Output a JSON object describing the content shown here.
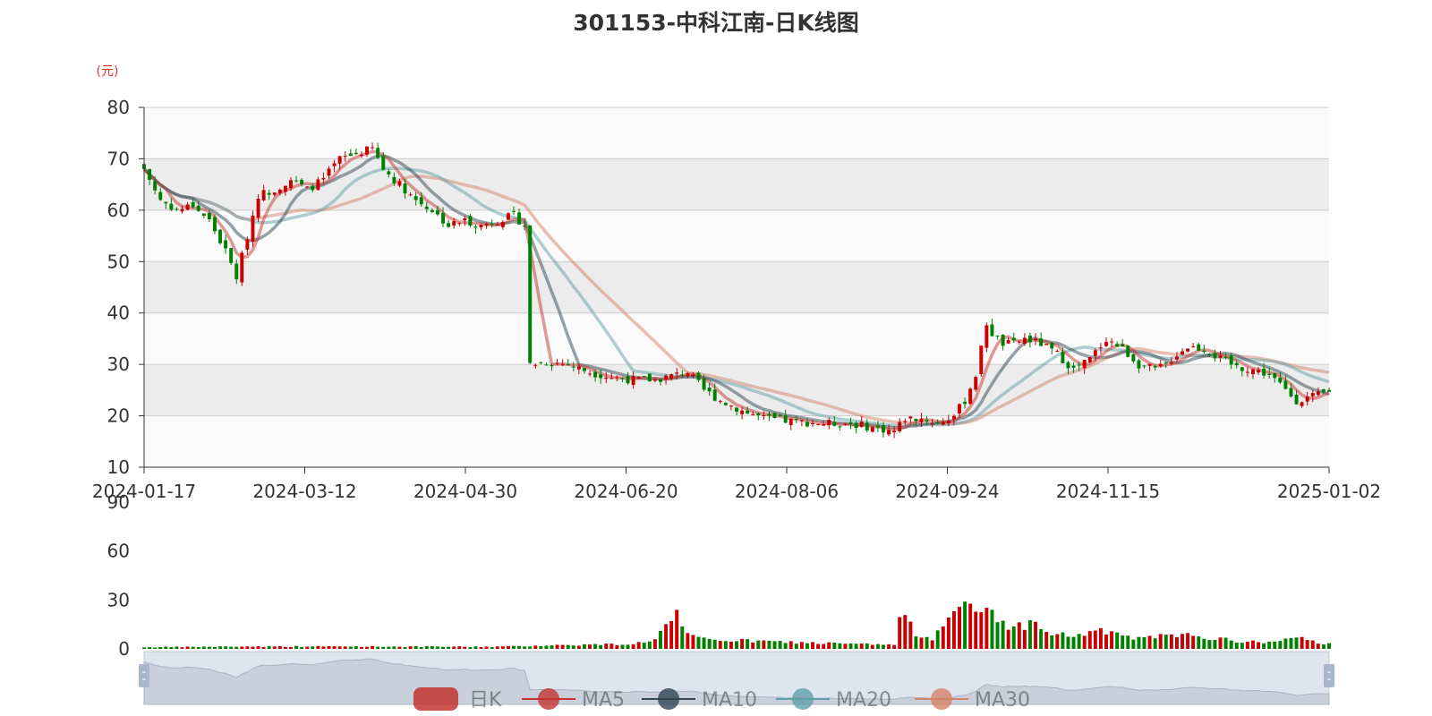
{
  "chart_data": {
    "type": "candlestick",
    "title": "301153-中科江南-日K线图",
    "y_unit": "(元)",
    "price_ylim": [
      10,
      80
    ],
    "price_yticks": [
      "80",
      "70",
      "60",
      "50",
      "40",
      "30",
      "20",
      "10"
    ],
    "volume_ylim": [
      0,
      90
    ],
    "volume_yticks": [
      "90",
      "60",
      "30",
      "0"
    ],
    "x_tick_labels": [
      "2024-01-17",
      "2024-03-12",
      "2024-04-30",
      "2024-06-20",
      "2024-08-06",
      "2024-09-24",
      "2024-11-15",
      "2025-01-02"
    ],
    "legend": [
      {
        "name": "日K",
        "color": "#c23531"
      },
      {
        "name": "MA5",
        "color": "#c23531"
      },
      {
        "name": "MA10",
        "color": "#2f4554"
      },
      {
        "name": "MA20",
        "color": "#61a0a8"
      },
      {
        "name": "MA30",
        "color": "#d48265"
      }
    ],
    "up_color": "#c80000",
    "down_color": "#008000",
    "grid": true,
    "close_anchors": [
      [
        0,
        68
      ],
      [
        3,
        62
      ],
      [
        6,
        60
      ],
      [
        9,
        61
      ],
      [
        12,
        58
      ],
      [
        15,
        52
      ],
      [
        17,
        47
      ],
      [
        19,
        55
      ],
      [
        21,
        63
      ],
      [
        24,
        64
      ],
      [
        27,
        66
      ],
      [
        30,
        64
      ],
      [
        33,
        66
      ],
      [
        36,
        70
      ],
      [
        39,
        71
      ],
      [
        42,
        72
      ],
      [
        44,
        68
      ],
      [
        47,
        65
      ],
      [
        50,
        62
      ],
      [
        53,
        60
      ],
      [
        56,
        57
      ],
      [
        59,
        58
      ],
      [
        62,
        57
      ],
      [
        65,
        58
      ],
      [
        68,
        59
      ],
      [
        70,
        57
      ],
      [
        71,
        30
      ],
      [
        74,
        30.5
      ],
      [
        78,
        30
      ],
      [
        82,
        28.5
      ],
      [
        86,
        27.5
      ],
      [
        90,
        27
      ],
      [
        94,
        27
      ],
      [
        98,
        28
      ],
      [
        100,
        28.5
      ],
      [
        103,
        25
      ],
      [
        106,
        23
      ],
      [
        110,
        21
      ],
      [
        114,
        19.5
      ],
      [
        118,
        19
      ],
      [
        125,
        18.5
      ],
      [
        130,
        18.5
      ],
      [
        135,
        17.5
      ],
      [
        138,
        17
      ],
      [
        140,
        19.5
      ],
      [
        143,
        19.5
      ],
      [
        146,
        18.5
      ],
      [
        149,
        20
      ],
      [
        151,
        23
      ],
      [
        153,
        28
      ],
      [
        155,
        38
      ],
      [
        156,
        36
      ],
      [
        158,
        34
      ],
      [
        160,
        34
      ],
      [
        162,
        35
      ],
      [
        165,
        34
      ],
      [
        168,
        32
      ],
      [
        171,
        29
      ],
      [
        174,
        31
      ],
      [
        177,
        35
      ],
      [
        180,
        33
      ],
      [
        183,
        30
      ],
      [
        186,
        29
      ],
      [
        188,
        30
      ],
      [
        190,
        32
      ],
      [
        192,
        33.5
      ],
      [
        195,
        33
      ],
      [
        198,
        31
      ],
      [
        201,
        29.5
      ],
      [
        204,
        29
      ],
      [
        207,
        28
      ],
      [
        210,
        25
      ],
      [
        212,
        23
      ],
      [
        214,
        23.5
      ],
      [
        216,
        24
      ],
      [
        218,
        24.5
      ]
    ],
    "volume_anchors": [
      [
        0,
        1
      ],
      [
        20,
        1.5
      ],
      [
        40,
        1.5
      ],
      [
        60,
        1.3
      ],
      [
        68,
        1.5
      ],
      [
        72,
        2
      ],
      [
        80,
        2.5
      ],
      [
        90,
        3
      ],
      [
        94,
        6
      ],
      [
        96,
        14
      ],
      [
        98,
        20
      ],
      [
        99,
        12
      ],
      [
        100,
        8
      ],
      [
        103,
        6
      ],
      [
        110,
        5
      ],
      [
        120,
        4
      ],
      [
        130,
        3
      ],
      [
        138,
        2.5
      ],
      [
        139,
        20
      ],
      [
        140,
        17
      ],
      [
        142,
        10
      ],
      [
        145,
        6
      ],
      [
        146,
        13
      ],
      [
        148,
        23
      ],
      [
        151,
        24
      ],
      [
        154,
        22
      ],
      [
        155,
        25
      ],
      [
        157,
        20
      ],
      [
        160,
        12
      ],
      [
        163,
        17
      ],
      [
        166,
        10
      ],
      [
        170,
        8
      ],
      [
        175,
        10
      ],
      [
        178,
        11
      ],
      [
        181,
        7
      ],
      [
        184,
        6
      ],
      [
        187,
        8
      ],
      [
        190,
        7
      ],
      [
        193,
        9
      ],
      [
        196,
        7
      ],
      [
        200,
        5
      ],
      [
        205,
        4
      ],
      [
        209,
        5
      ],
      [
        212,
        6.5
      ],
      [
        216,
        4
      ],
      [
        218,
        3
      ]
    ]
  }
}
